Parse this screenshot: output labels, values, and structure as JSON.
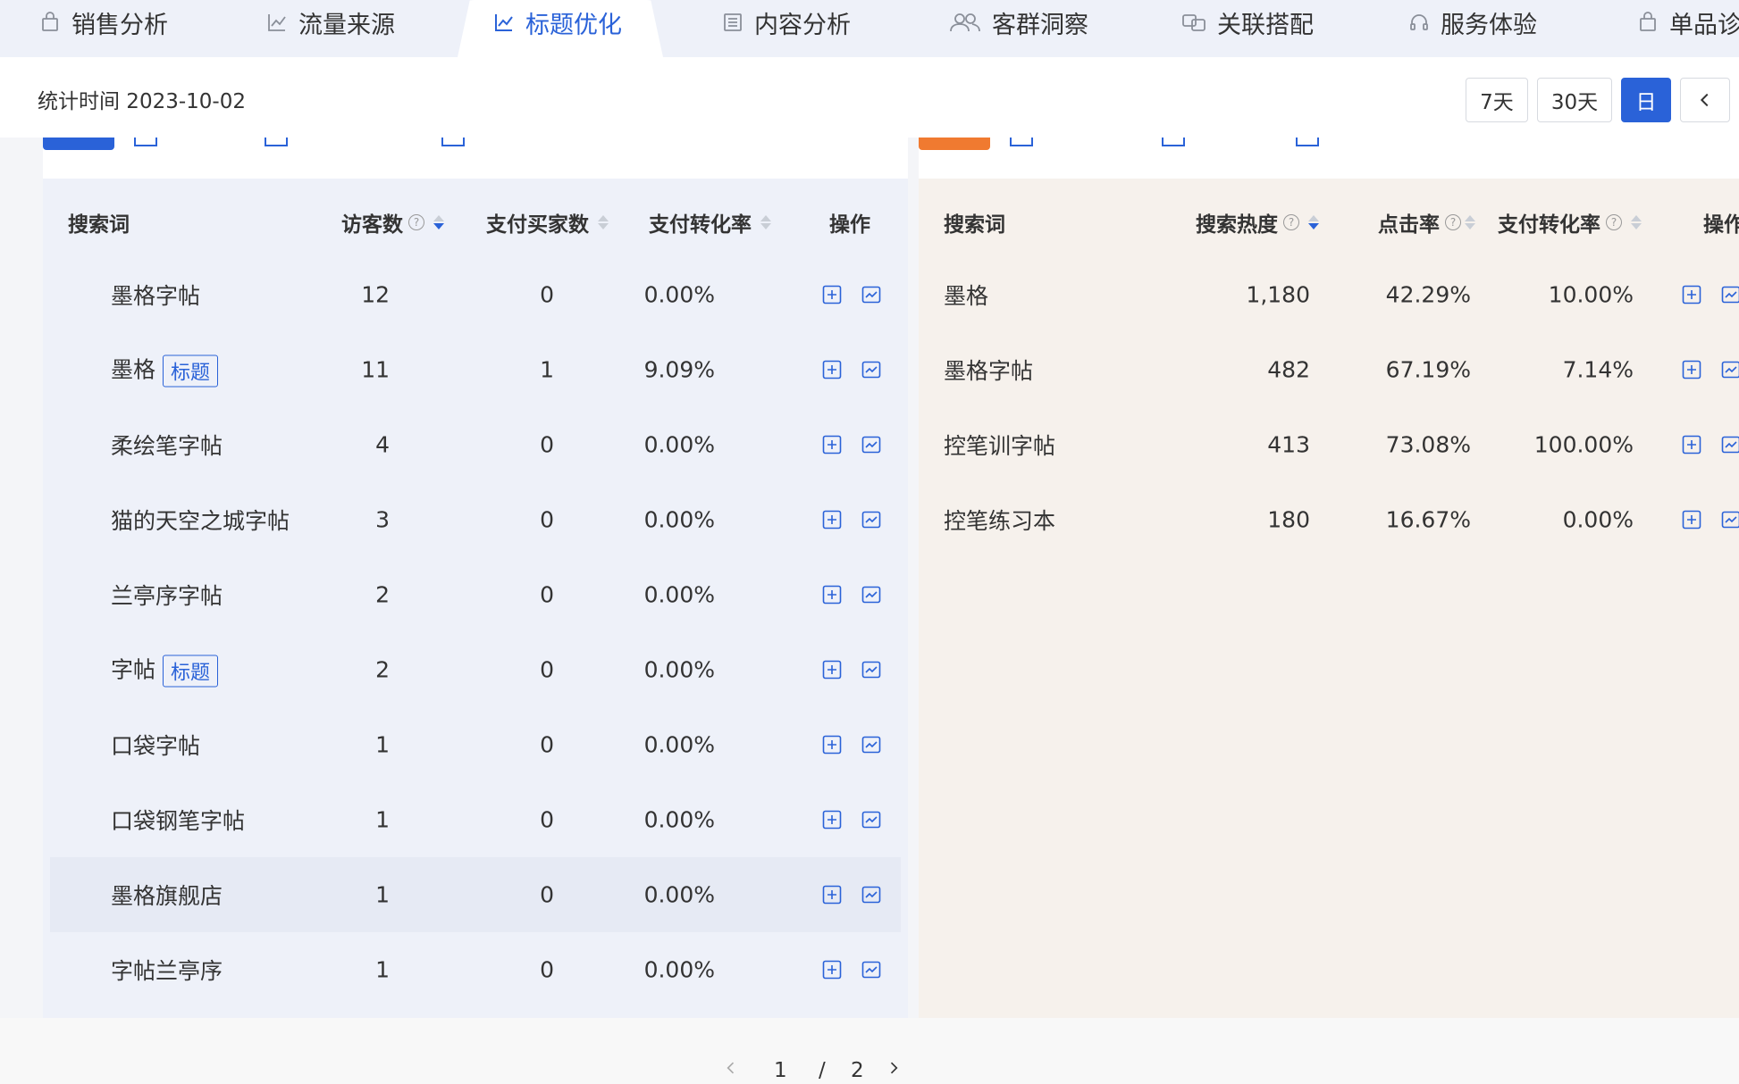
{
  "nav": {
    "tabs": [
      {
        "label": "销售分析",
        "icon": "bag-icon"
      },
      {
        "label": "流量来源",
        "icon": "trend-icon"
      },
      {
        "label": "标题优化",
        "icon": "trend-icon",
        "active": true
      },
      {
        "label": "内容分析",
        "icon": "list-icon"
      },
      {
        "label": "客群洞察",
        "icon": "users-icon"
      },
      {
        "label": "关联搭配",
        "icon": "link-icon"
      },
      {
        "label": "服务体验",
        "icon": "headset-icon"
      },
      {
        "label": "单品诊",
        "icon": "bag-icon"
      }
    ]
  },
  "header": {
    "stat_time": "统计时间 2023-10-02",
    "period_buttons": [
      "7天",
      "30天",
      "日"
    ],
    "active_period": "日"
  },
  "left_table": {
    "headers": {
      "keyword": "搜索词",
      "visitors": "访客数",
      "buyers": "支付买家数",
      "conversion": "支付转化率",
      "ops": "操作"
    },
    "rows": [
      {
        "keyword": "墨格字帖",
        "tag": "",
        "visitors": "12",
        "buyers": "0",
        "conversion": "0.00%"
      },
      {
        "keyword": "墨格",
        "tag": "标题",
        "visitors": "11",
        "buyers": "1",
        "conversion": "9.09%"
      },
      {
        "keyword": "柔绘笔字帖",
        "tag": "",
        "visitors": "4",
        "buyers": "0",
        "conversion": "0.00%"
      },
      {
        "keyword": "猫的天空之城字帖",
        "tag": "",
        "visitors": "3",
        "buyers": "0",
        "conversion": "0.00%"
      },
      {
        "keyword": "兰亭序字帖",
        "tag": "",
        "visitors": "2",
        "buyers": "0",
        "conversion": "0.00%"
      },
      {
        "keyword": "字帖",
        "tag": "标题",
        "visitors": "2",
        "buyers": "0",
        "conversion": "0.00%"
      },
      {
        "keyword": "口袋字帖",
        "tag": "",
        "visitors": "1",
        "buyers": "0",
        "conversion": "0.00%"
      },
      {
        "keyword": "口袋钢笔字帖",
        "tag": "",
        "visitors": "1",
        "buyers": "0",
        "conversion": "0.00%"
      },
      {
        "keyword": "墨格旗舰店",
        "tag": "",
        "visitors": "1",
        "buyers": "0",
        "conversion": "0.00%",
        "highlighted": true
      },
      {
        "keyword": "字帖兰亭序",
        "tag": "",
        "visitors": "1",
        "buyers": "0",
        "conversion": "0.00%"
      }
    ]
  },
  "right_table": {
    "headers": {
      "keyword": "搜索词",
      "heat": "搜索热度",
      "ctr": "点击率",
      "conversion": "支付转化率",
      "ops": "操作"
    },
    "rows": [
      {
        "keyword": "墨格",
        "heat": "1,180",
        "ctr": "42.29%",
        "conversion": "10.00%"
      },
      {
        "keyword": "墨格字帖",
        "heat": "482",
        "ctr": "67.19%",
        "conversion": "7.14%"
      },
      {
        "keyword": "控笔训字帖",
        "heat": "413",
        "ctr": "73.08%",
        "conversion": "100.00%"
      },
      {
        "keyword": "控笔练习本",
        "heat": "180",
        "ctr": "16.67%",
        "conversion": "0.00%"
      }
    ]
  },
  "pagination": {
    "current": "1",
    "separator": "/",
    "total": "2"
  },
  "colors": {
    "accent": "#2a62d8",
    "orange": "#f07a30",
    "left_bg": "#eef1f9",
    "right_bg": "#f6f1ec"
  }
}
